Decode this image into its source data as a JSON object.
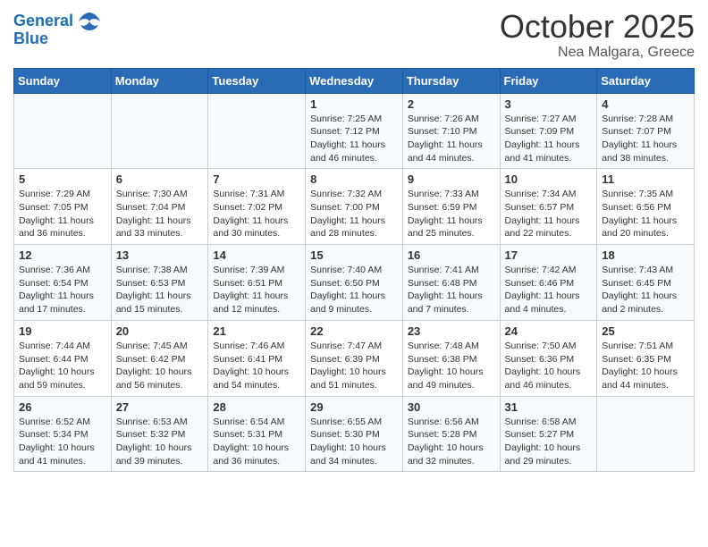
{
  "header": {
    "logo_line1": "General",
    "logo_line2": "Blue",
    "title": "October 2025",
    "subtitle": "Nea Malgara, Greece"
  },
  "calendar": {
    "days_of_week": [
      "Sunday",
      "Monday",
      "Tuesday",
      "Wednesday",
      "Thursday",
      "Friday",
      "Saturday"
    ],
    "weeks": [
      [
        {
          "day": "",
          "info": ""
        },
        {
          "day": "",
          "info": ""
        },
        {
          "day": "",
          "info": ""
        },
        {
          "day": "1",
          "info": "Sunrise: 7:25 AM\nSunset: 7:12 PM\nDaylight: 11 hours and 46 minutes."
        },
        {
          "day": "2",
          "info": "Sunrise: 7:26 AM\nSunset: 7:10 PM\nDaylight: 11 hours and 44 minutes."
        },
        {
          "day": "3",
          "info": "Sunrise: 7:27 AM\nSunset: 7:09 PM\nDaylight: 11 hours and 41 minutes."
        },
        {
          "day": "4",
          "info": "Sunrise: 7:28 AM\nSunset: 7:07 PM\nDaylight: 11 hours and 38 minutes."
        }
      ],
      [
        {
          "day": "5",
          "info": "Sunrise: 7:29 AM\nSunset: 7:05 PM\nDaylight: 11 hours and 36 minutes."
        },
        {
          "day": "6",
          "info": "Sunrise: 7:30 AM\nSunset: 7:04 PM\nDaylight: 11 hours and 33 minutes."
        },
        {
          "day": "7",
          "info": "Sunrise: 7:31 AM\nSunset: 7:02 PM\nDaylight: 11 hours and 30 minutes."
        },
        {
          "day": "8",
          "info": "Sunrise: 7:32 AM\nSunset: 7:00 PM\nDaylight: 11 hours and 28 minutes."
        },
        {
          "day": "9",
          "info": "Sunrise: 7:33 AM\nSunset: 6:59 PM\nDaylight: 11 hours and 25 minutes."
        },
        {
          "day": "10",
          "info": "Sunrise: 7:34 AM\nSunset: 6:57 PM\nDaylight: 11 hours and 22 minutes."
        },
        {
          "day": "11",
          "info": "Sunrise: 7:35 AM\nSunset: 6:56 PM\nDaylight: 11 hours and 20 minutes."
        }
      ],
      [
        {
          "day": "12",
          "info": "Sunrise: 7:36 AM\nSunset: 6:54 PM\nDaylight: 11 hours and 17 minutes."
        },
        {
          "day": "13",
          "info": "Sunrise: 7:38 AM\nSunset: 6:53 PM\nDaylight: 11 hours and 15 minutes."
        },
        {
          "day": "14",
          "info": "Sunrise: 7:39 AM\nSunset: 6:51 PM\nDaylight: 11 hours and 12 minutes."
        },
        {
          "day": "15",
          "info": "Sunrise: 7:40 AM\nSunset: 6:50 PM\nDaylight: 11 hours and 9 minutes."
        },
        {
          "day": "16",
          "info": "Sunrise: 7:41 AM\nSunset: 6:48 PM\nDaylight: 11 hours and 7 minutes."
        },
        {
          "day": "17",
          "info": "Sunrise: 7:42 AM\nSunset: 6:46 PM\nDaylight: 11 hours and 4 minutes."
        },
        {
          "day": "18",
          "info": "Sunrise: 7:43 AM\nSunset: 6:45 PM\nDaylight: 11 hours and 2 minutes."
        }
      ],
      [
        {
          "day": "19",
          "info": "Sunrise: 7:44 AM\nSunset: 6:44 PM\nDaylight: 10 hours and 59 minutes."
        },
        {
          "day": "20",
          "info": "Sunrise: 7:45 AM\nSunset: 6:42 PM\nDaylight: 10 hours and 56 minutes."
        },
        {
          "day": "21",
          "info": "Sunrise: 7:46 AM\nSunset: 6:41 PM\nDaylight: 10 hours and 54 minutes."
        },
        {
          "day": "22",
          "info": "Sunrise: 7:47 AM\nSunset: 6:39 PM\nDaylight: 10 hours and 51 minutes."
        },
        {
          "day": "23",
          "info": "Sunrise: 7:48 AM\nSunset: 6:38 PM\nDaylight: 10 hours and 49 minutes."
        },
        {
          "day": "24",
          "info": "Sunrise: 7:50 AM\nSunset: 6:36 PM\nDaylight: 10 hours and 46 minutes."
        },
        {
          "day": "25",
          "info": "Sunrise: 7:51 AM\nSunset: 6:35 PM\nDaylight: 10 hours and 44 minutes."
        }
      ],
      [
        {
          "day": "26",
          "info": "Sunrise: 6:52 AM\nSunset: 5:34 PM\nDaylight: 10 hours and 41 minutes."
        },
        {
          "day": "27",
          "info": "Sunrise: 6:53 AM\nSunset: 5:32 PM\nDaylight: 10 hours and 39 minutes."
        },
        {
          "day": "28",
          "info": "Sunrise: 6:54 AM\nSunset: 5:31 PM\nDaylight: 10 hours and 36 minutes."
        },
        {
          "day": "29",
          "info": "Sunrise: 6:55 AM\nSunset: 5:30 PM\nDaylight: 10 hours and 34 minutes."
        },
        {
          "day": "30",
          "info": "Sunrise: 6:56 AM\nSunset: 5:28 PM\nDaylight: 10 hours and 32 minutes."
        },
        {
          "day": "31",
          "info": "Sunrise: 6:58 AM\nSunset: 5:27 PM\nDaylight: 10 hours and 29 minutes."
        },
        {
          "day": "",
          "info": ""
        }
      ]
    ]
  }
}
